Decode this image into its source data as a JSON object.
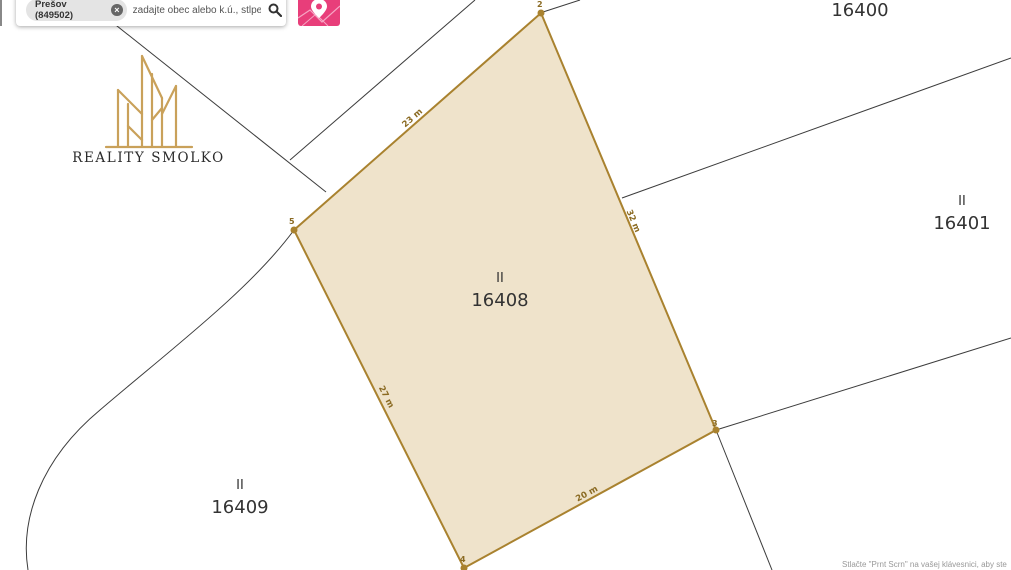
{
  "search": {
    "chip_label": "Prešov (849502)",
    "placeholder": "zadajte obec alebo k.ú., stlpec",
    "search_icon": "search-icon",
    "clear_icon": "close-icon"
  },
  "map_button": {
    "icon": "map-pin-icon",
    "color": "#e83e7a"
  },
  "logo": {
    "text": "REALITY SMOLKO",
    "color": "#c9a15a"
  },
  "parcels": [
    {
      "id": "parcel-16408",
      "type": "II",
      "number": "16408",
      "highlighted": true
    },
    {
      "id": "parcel-16401",
      "type": "II",
      "number": "16401"
    },
    {
      "id": "parcel-16409",
      "type": "II",
      "number": "16409"
    },
    {
      "id": "parcel-16400",
      "number": "16400"
    }
  ],
  "vertices": [
    "2",
    "3",
    "4",
    "5"
  ],
  "dimensions": [
    "23 m",
    "32 m",
    "20 m",
    "27 m"
  ],
  "colors": {
    "parcel_fill": "#efe3cb",
    "parcel_edge": "#a9822f",
    "lines": "#3c3c3c"
  },
  "footer": {
    "notice": "Stlačte \"Prnt Scrn\" na vašej klávesnici, aby ste"
  }
}
